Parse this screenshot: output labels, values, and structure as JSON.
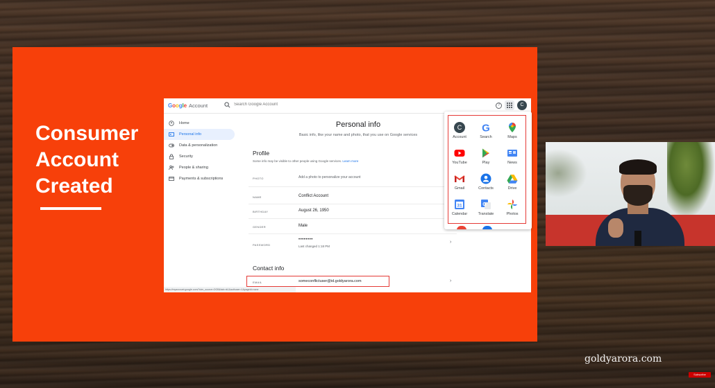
{
  "slide": {
    "title_line1": "Consumer",
    "title_line2": "Account",
    "title_line3": "Created"
  },
  "header": {
    "logo_letters": [
      "G",
      "o",
      "o",
      "g",
      "l",
      "e"
    ],
    "product": "Account",
    "search_placeholder": "Search Google Account",
    "avatar_letter": "C",
    "help_glyph": "?"
  },
  "nav": {
    "items": [
      {
        "label": "Home",
        "icon": "home-icon"
      },
      {
        "label": "Personal info",
        "icon": "id-card-icon",
        "active": true
      },
      {
        "label": "Data & personalization",
        "icon": "toggle-icon"
      },
      {
        "label": "Security",
        "icon": "lock-icon"
      },
      {
        "label": "People & sharing",
        "icon": "people-icon"
      },
      {
        "label": "Payments & subscriptions",
        "icon": "card-icon"
      }
    ]
  },
  "main": {
    "title": "Personal info",
    "subtitle": "Basic info, like your name and photo, that you use on Google services",
    "profile": {
      "heading": "Profile",
      "note": "Some info may be visible to other people using Google services.",
      "learn_more": "Learn more",
      "rows": [
        {
          "label": "PHOTO",
          "value": "Add a photo to personalize your account"
        },
        {
          "label": "NAME",
          "value": "Conflict Account"
        },
        {
          "label": "BIRTHDAY",
          "value": "August 26, 1950"
        },
        {
          "label": "GENDER",
          "value": "Male"
        },
        {
          "label": "PASSWORD",
          "value": "••••••••",
          "sub": "Last changed 1:18 PM"
        }
      ]
    },
    "contact": {
      "heading": "Contact info",
      "rows": [
        {
          "label": "EMAIL",
          "value": "someconflictuser@id.goldyarora.com"
        }
      ]
    },
    "chevron": "›",
    "status_url": "https://myaccount.google.com/?utm_source=OGB&tab=rk1&authuser=1&pageId=none"
  },
  "apps": [
    {
      "label": "Account",
      "icon": "account-avatar-icon",
      "glyph": "C"
    },
    {
      "label": "Search",
      "icon": "google-search-icon",
      "glyph": "G"
    },
    {
      "label": "Maps",
      "icon": "maps-pin-icon"
    },
    {
      "label": "YouTube",
      "icon": "youtube-icon"
    },
    {
      "label": "Play",
      "icon": "play-store-icon"
    },
    {
      "label": "News",
      "icon": "news-icon"
    },
    {
      "label": "Gmail",
      "icon": "gmail-icon",
      "glyph": "M"
    },
    {
      "label": "Contacts",
      "icon": "contacts-icon"
    },
    {
      "label": "Drive",
      "icon": "drive-icon"
    },
    {
      "label": "Calendar",
      "icon": "calendar-icon",
      "glyph": "31"
    },
    {
      "label": "Translate",
      "icon": "translate-icon",
      "glyph": "G"
    },
    {
      "label": "Photos",
      "icon": "photos-pinwheel-icon"
    }
  ],
  "branding": {
    "site": "goldyarora.com",
    "subscribe": "Subscribe"
  },
  "colors": {
    "slide_orange": "#f7400a",
    "highlight_red": "#e53935",
    "google_blue": "#4285f4",
    "google_red": "#ea4335",
    "google_yellow": "#fbbc05",
    "google_green": "#34a853"
  }
}
